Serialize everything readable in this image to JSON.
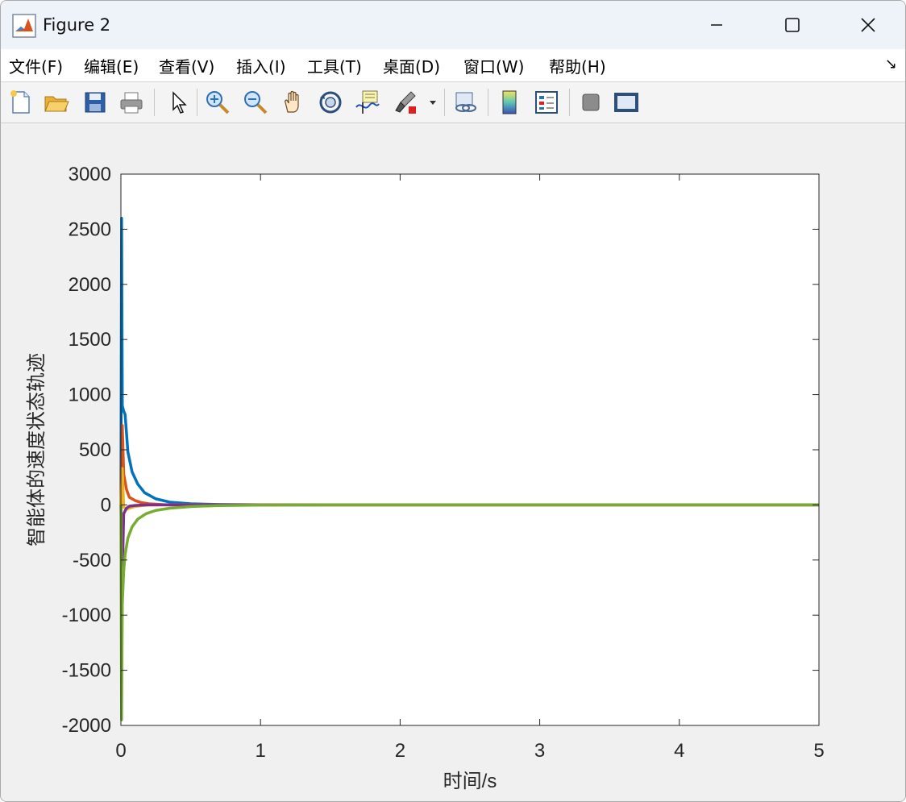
{
  "window": {
    "title": "Figure 2"
  },
  "menu": [
    "文件(F)",
    "编辑(E)",
    "查看(V)",
    "插入(I)",
    "工具(T)",
    "桌面(D)",
    "窗口(W)",
    "帮助(H)"
  ],
  "menu_dock_glyph": "↘",
  "toolbar": [
    {
      "icon": "new-figure-icon"
    },
    {
      "icon": "open-file-icon"
    },
    {
      "icon": "save-icon"
    },
    {
      "icon": "print-icon"
    },
    {
      "icon": "pointer-icon"
    },
    {
      "icon": "zoom-in-icon"
    },
    {
      "icon": "zoom-out-icon"
    },
    {
      "icon": "pan-icon"
    },
    {
      "icon": "rotate-3d-icon"
    },
    {
      "icon": "data-cursor-icon"
    },
    {
      "icon": "brush-icon"
    },
    {
      "icon": "link-plot-icon"
    },
    {
      "icon": "colorbar-icon"
    },
    {
      "icon": "legend-icon"
    },
    {
      "icon": "hide-plot-tools-icon"
    },
    {
      "icon": "show-plot-tools-icon"
    }
  ],
  "chart_data": {
    "type": "line",
    "title": "",
    "xlabel": "时间/s",
    "ylabel": "智能体的速度状态轨迹",
    "xlim": [
      0,
      5
    ],
    "ylim": [
      -2000,
      3000
    ],
    "xticks": [
      "0",
      "1",
      "2",
      "3",
      "4",
      "5"
    ],
    "yticks": [
      "-2000",
      "-1500",
      "-1000",
      "-500",
      "0",
      "500",
      "1000",
      "1500",
      "2000",
      "2500",
      "3000"
    ],
    "grid": false,
    "legend": "none",
    "series": [
      {
        "color": "#0072BD",
        "x": [
          0,
          0.005,
          0.01,
          0.02,
          0.03,
          0.05,
          0.08,
          0.12,
          0.17,
          0.25,
          0.35,
          0.5,
          0.7,
          1.0,
          1.5,
          5
        ],
        "y": [
          0,
          2600,
          900,
          850,
          820,
          480,
          300,
          190,
          110,
          55,
          25,
          10,
          4,
          1,
          0,
          0
        ]
      },
      {
        "color": "#D95319",
        "x": [
          0,
          0.01,
          0.02,
          0.04,
          0.06,
          0.1,
          0.15,
          0.2,
          0.3,
          0.5,
          1.0,
          5
        ],
        "y": [
          0,
          720,
          280,
          140,
          70,
          40,
          20,
          10,
          3,
          0,
          0,
          0
        ]
      },
      {
        "color": "#EDB120",
        "x": [
          0,
          0.01,
          0.02,
          0.04,
          0.06,
          0.1,
          0.15,
          0.2,
          0.3,
          0.5,
          5
        ],
        "y": [
          0,
          330,
          -20,
          -40,
          -30,
          -15,
          -6,
          -2,
          0,
          0,
          0
        ]
      },
      {
        "color": "#7E2F8E",
        "x": [
          0,
          0.01,
          0.02,
          0.04,
          0.06,
          0.1,
          0.15,
          0.2,
          0.3,
          0.5,
          5
        ],
        "y": [
          0,
          -650,
          -80,
          -30,
          -12,
          -5,
          -2,
          0,
          0,
          0,
          0
        ]
      },
      {
        "color": "#77AC30",
        "x": [
          0,
          0.005,
          0.01,
          0.02,
          0.03,
          0.05,
          0.08,
          0.12,
          0.18,
          0.25,
          0.35,
          0.5,
          0.7,
          1.0,
          1.5,
          5
        ],
        "y": [
          0,
          -1950,
          -900,
          -600,
          -450,
          -300,
          -200,
          -130,
          -80,
          -50,
          -30,
          -15,
          -6,
          -2,
          0,
          0
        ]
      }
    ]
  }
}
